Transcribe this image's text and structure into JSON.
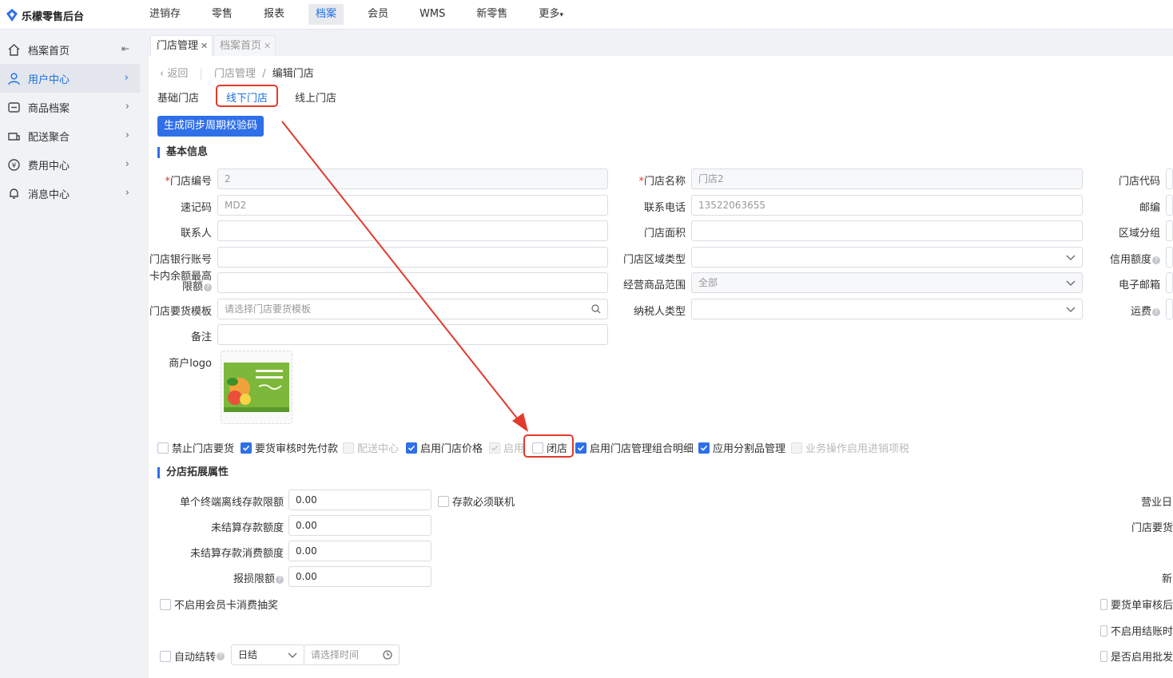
{
  "app": {
    "title": "乐檬零售后台"
  },
  "nav": [
    "进销存",
    "零售",
    "报表",
    "档案",
    "会员",
    "WMS",
    "新零售",
    "更多"
  ],
  "nav_active": "档案",
  "sidebar": [
    {
      "label": "档案首页",
      "icon": "home-icon"
    },
    {
      "label": "用户中心",
      "icon": "user-icon"
    },
    {
      "label": "商品档案",
      "icon": "goods-icon"
    },
    {
      "label": "配送聚合",
      "icon": "delivery-icon"
    },
    {
      "label": "费用中心",
      "icon": "yen-icon"
    },
    {
      "label": "消息中心",
      "icon": "bell-icon"
    }
  ],
  "tabs": [
    {
      "label": "门店管理"
    },
    {
      "label": "档案首页"
    }
  ],
  "breadcrumb": {
    "back": "返回",
    "parent": "门店管理",
    "sep": "/",
    "current": "编辑门店"
  },
  "subtabs": [
    "基础门店",
    "线下门店",
    "线上门店"
  ],
  "generate_button": "生成同步周期校验码",
  "section_basic": "基本信息",
  "form": {
    "store_no": {
      "label": "门店编号",
      "value": "2"
    },
    "quick_code": {
      "label": "速记码",
      "value": "MD2"
    },
    "contact": {
      "label": "联系人",
      "value": ""
    },
    "bank_account": {
      "label": "门店银行账号",
      "value": ""
    },
    "card_limit": {
      "label1": "卡内余额最高",
      "label2": "限额",
      "value": ""
    },
    "order_template": {
      "label": "门店要货模板",
      "placeholder": "请选择门店要货模板"
    },
    "remark": {
      "label": "备注",
      "value": ""
    },
    "merchant_logo": {
      "label": "商户logo"
    },
    "store_name": {
      "label": "门店名称",
      "value": "门店2"
    },
    "phone": {
      "label": "联系电话",
      "value": "13522063655"
    },
    "area": {
      "label": "门店面积",
      "value": ""
    },
    "region_type": {
      "label": "门店区域类型",
      "value": ""
    },
    "goods_scope": {
      "label": "经营商品范围",
      "value": "全部"
    },
    "taxpayer_type": {
      "label": "纳税人类型",
      "value": ""
    },
    "store_code": {
      "label": "门店代码"
    },
    "postcode": {
      "label": "邮编"
    },
    "region_group": {
      "label": "区域分组"
    },
    "credit_limit": {
      "label": "信用额度"
    },
    "email": {
      "label": "电子邮箱"
    },
    "freight": {
      "label": "运费"
    }
  },
  "checkboxes": [
    {
      "label": "禁止门店要货",
      "checked": false,
      "disabled": false
    },
    {
      "label": "要货审核时先付款",
      "checked": true,
      "disabled": false
    },
    {
      "label": "配送中心",
      "checked": false,
      "disabled": true
    },
    {
      "label": "启用门店价格",
      "checked": true,
      "disabled": false
    },
    {
      "label": "启用",
      "checked": true,
      "disabled": true
    },
    {
      "label": "闭店",
      "checked": false,
      "disabled": false
    },
    {
      "label": "启用门店管理组合明细",
      "checked": true,
      "disabled": false
    },
    {
      "label": "应用分割品管理",
      "checked": true,
      "disabled": false
    },
    {
      "label": "业务操作启用进销项税",
      "checked": false,
      "disabled": true
    }
  ],
  "section_ext": "分店拓展属性",
  "ext": {
    "offline_limit": {
      "label": "单个终端离线存款限额",
      "value": "0.00"
    },
    "deposit_online": {
      "label": "存款必须联机"
    },
    "unsettled_limit": {
      "label": "未结算存款额度",
      "value": "0.00"
    },
    "unsettled_consume": {
      "label": "未结算存款消费额度",
      "value": "0.00"
    },
    "loss_limit": {
      "label": "报损限额",
      "value": "0.00"
    },
    "no_lottery": {
      "label": "不启用会员卡消费抽奖"
    },
    "auto_carry": {
      "label": "自动结转",
      "period": "日结",
      "time_placeholder": "请选择时间"
    },
    "right_biz_day": {
      "label": "营业日"
    },
    "right_order": {
      "label": "门店要货"
    },
    "right_new": {
      "label": "新"
    },
    "right_cb1": {
      "label": "要货单审核后"
    },
    "right_cb2": {
      "label": "不启用结账时"
    },
    "right_cb3": {
      "label": "是否启用批发"
    }
  },
  "colors": {
    "accent": "#2f6fe8",
    "highlight": "#e23a2e"
  }
}
